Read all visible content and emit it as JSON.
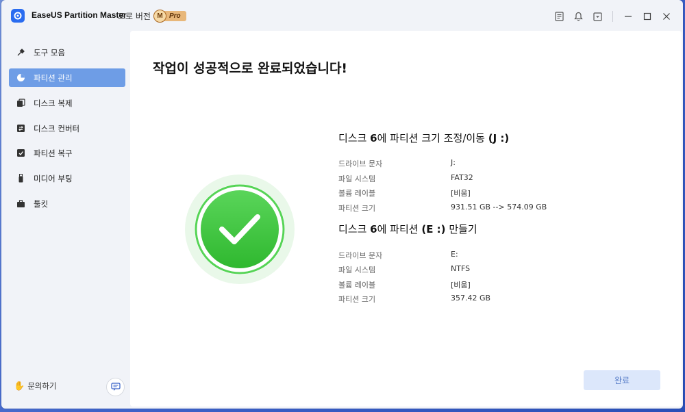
{
  "app": {
    "title": "EaseUS Partition Master",
    "edition": "프로 버전",
    "badge_m": "M",
    "badge_pro": "Pro"
  },
  "titlebar_icons": [
    "notes-icon",
    "bell-icon",
    "dropdown-box-icon",
    "minimize-icon",
    "maximize-icon",
    "close-icon"
  ],
  "sidebar": {
    "items": [
      {
        "label": "도구 모음",
        "icon": "tools-icon",
        "active": false
      },
      {
        "label": "파티션 관리",
        "icon": "pie-chart-icon",
        "active": true
      },
      {
        "label": "디스크 복제",
        "icon": "clone-icon",
        "active": false
      },
      {
        "label": "디스크 컨버터",
        "icon": "converter-icon",
        "active": false
      },
      {
        "label": "파티션 복구",
        "icon": "recovery-icon",
        "active": false
      },
      {
        "label": "미디어 부팅",
        "icon": "usb-icon",
        "active": false
      },
      {
        "label": "툴킷",
        "icon": "toolkit-icon",
        "active": false
      }
    ],
    "help_label": "문의하기"
  },
  "main": {
    "heading": "작업이 성공적으로 완료되었습니다!",
    "sections": [
      {
        "title_pre": "디스크 ",
        "title_num": "6",
        "title_mid": "에 파티션 크기 조정/이동 ",
        "title_bold": "(J :)",
        "title_post": "",
        "rows": [
          {
            "label": "드라이브 문자",
            "value": "J:"
          },
          {
            "label": "파일 시스템",
            "value": "FAT32"
          },
          {
            "label": "볼륨 레이블",
            "value": "[비움]"
          },
          {
            "label": "파티션 크기",
            "value": "931.51 GB --> 574.09 GB"
          }
        ]
      },
      {
        "title_pre": "디스크 ",
        "title_num": "6",
        "title_mid": "에 파티션 ",
        "title_bold": "(E :)",
        "title_post": " 만들기",
        "rows": [
          {
            "label": "드라이브 문자",
            "value": "E:"
          },
          {
            "label": "파일 시스템",
            "value": "NTFS"
          },
          {
            "label": "볼륨 레이블",
            "value": "[비움]"
          },
          {
            "label": "파티션 크기",
            "value": "357.42 GB"
          }
        ]
      }
    ],
    "done_button": "완료"
  },
  "colors": {
    "accent": "#6e9de6",
    "success": "#3cc43c",
    "done_button_bg": "#dce7fb"
  }
}
